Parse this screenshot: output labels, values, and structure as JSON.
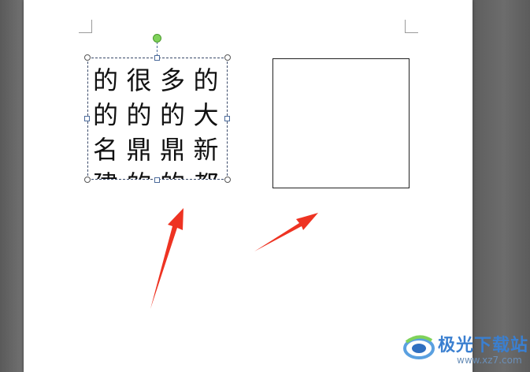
{
  "textbox": {
    "lines": [
      [
        "的",
        "很",
        "多",
        "",
        "的"
      ],
      [
        "的",
        "的",
        "的",
        "大"
      ],
      [
        "名",
        "鼎",
        "鼎",
        "",
        "新"
      ],
      [
        "建",
        "的",
        "的",
        "都"
      ]
    ]
  },
  "colors": {
    "arrow": "#ee3322",
    "rotate_handle": "#7fd25a",
    "selection_border": "#3a4a6a"
  },
  "icons": {
    "rotate": "rotate-handle-icon",
    "resize": "resize-handle-icon",
    "arrow": "annotation-arrow-icon",
    "watermark": "watermark-logo-icon"
  },
  "watermark": {
    "brand": "极光下载站",
    "url": "www.xz7.com"
  }
}
